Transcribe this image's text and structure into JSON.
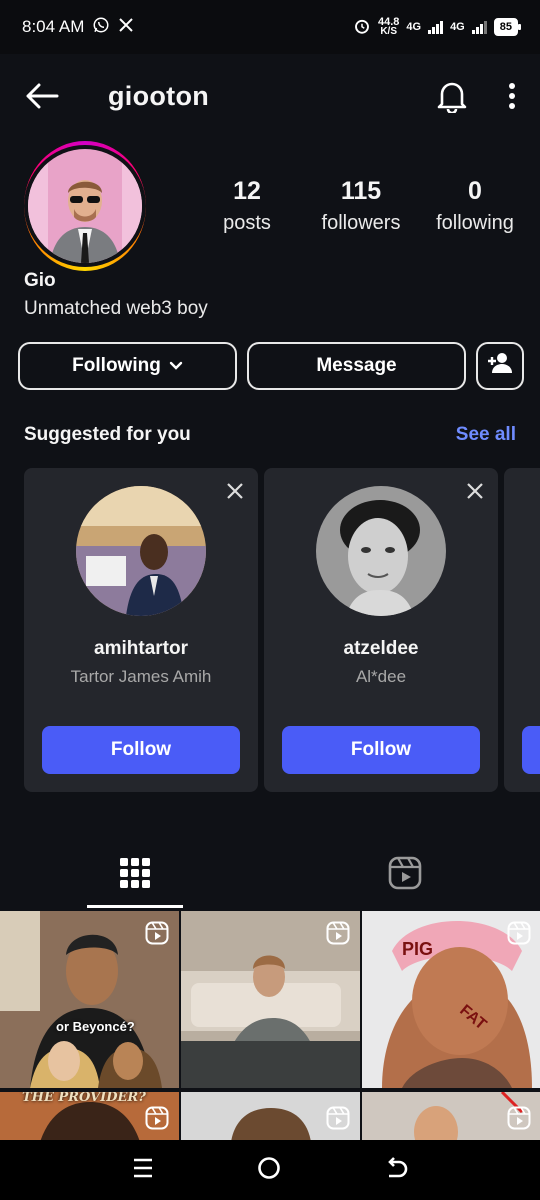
{
  "status_bar": {
    "time": "8:04 AM",
    "net_speed_value": "44.8",
    "net_speed_unit": "K/S",
    "signal1_label": "4G",
    "signal2_label": "4G",
    "battery": "85",
    "icons": [
      "whatsapp-icon",
      "x-icon",
      "alarm-icon",
      "signal-icon",
      "battery-icon"
    ]
  },
  "header": {
    "username": "giooton",
    "icons": [
      "back-arrow-icon",
      "bell-icon",
      "more-vertical-icon"
    ]
  },
  "profile": {
    "posts_count": "12",
    "posts_label": "posts",
    "followers_count": "115",
    "followers_label": "followers",
    "following_count": "0",
    "following_label": "following",
    "display_name": "Gio",
    "bio": "Unmatched web3 boy"
  },
  "actions": {
    "following_label": "Following",
    "message_label": "Message",
    "add_user_icon": "add-user-icon"
  },
  "suggested": {
    "title": "Suggested for you",
    "see_all": "See all",
    "cards": [
      {
        "username": "amihtartor",
        "name": "Tartor James Amih",
        "button": "Follow"
      },
      {
        "username": "atzeldee",
        "name": "Al*dee",
        "button": "Follow"
      }
    ]
  },
  "tabs": {
    "items": [
      "grid-icon",
      "reels-icon"
    ],
    "active": "grid"
  },
  "grid": {
    "thumb1_caption": "or Beyoncé?",
    "thumb1_footer": "THE PROVIDER?",
    "thumb3_text1": "PIG",
    "thumb3_text2": "FAT"
  },
  "colors": {
    "background": "#0f1116",
    "card": "#24262c",
    "accent": "#4a5cf7",
    "link": "#6f8cff"
  }
}
